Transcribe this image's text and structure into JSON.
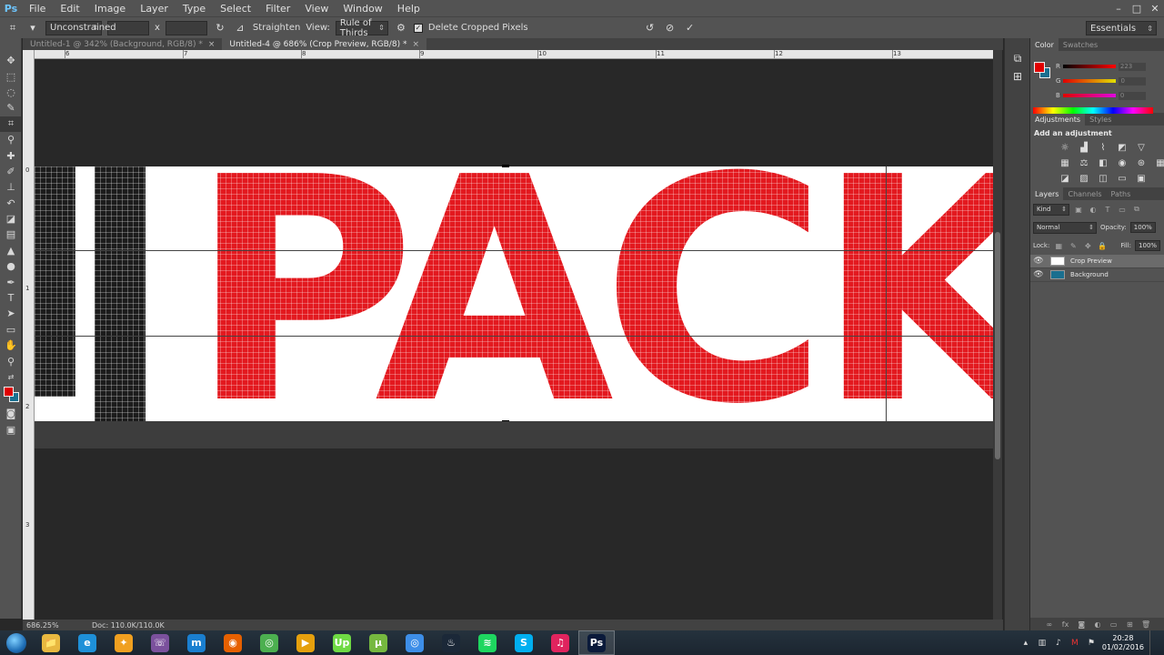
{
  "app": {
    "logo": "Ps"
  },
  "menu": [
    "File",
    "Edit",
    "Image",
    "Layer",
    "Type",
    "Select",
    "Filter",
    "View",
    "Window",
    "Help"
  ],
  "window_controls": [
    "–",
    "□",
    "✕"
  ],
  "options": {
    "ratio_select": "Unconstrained",
    "swap_label": "x",
    "straighten_label": "Straighten",
    "view_label": "View:",
    "view_select": "Rule of Thirds",
    "delete_cropped_label": "Delete Cropped Pixels",
    "delete_cropped_checked": true,
    "workspace": "Essentials"
  },
  "tabs": [
    {
      "label": "Untitled-1 @ 342% (Background, RGB/8) *",
      "active": false
    },
    {
      "label": "Untitled-4 @ 686% (Crop Preview, RGB/8) *",
      "active": true
    }
  ],
  "ruler_top": [
    "6",
    "7",
    "8",
    "9",
    "10",
    "11",
    "12",
    "13"
  ],
  "ruler_left": [
    "0",
    "1",
    "2",
    "3"
  ],
  "canvas": {
    "text": "PACK",
    "partial_letter": "d"
  },
  "status": {
    "zoom": "686.25%",
    "doc": "Doc: 110.0K/110.0K"
  },
  "panels": {
    "color_tabs": [
      "Color",
      "Swatches"
    ],
    "color": {
      "r_label": "R",
      "g_label": "G",
      "b_label": "B",
      "r_value": "223",
      "g_value": "0",
      "b_value": "0"
    },
    "adjust_tabs": [
      "Adjustments",
      "Styles"
    ],
    "adjust_title": "Add an adjustment",
    "layers_tabs": [
      "Layers",
      "Channels",
      "Paths"
    ],
    "kind_select": "Kind",
    "blend_mode": "Normal",
    "opacity_label": "Opacity:",
    "opacity_value": "100%",
    "lock_label": "Lock:",
    "fill_label": "Fill:",
    "fill_value": "100%",
    "layers": [
      {
        "name": "Crop Preview",
        "selected": true
      },
      {
        "name": "Background",
        "selected": false
      }
    ]
  },
  "taskbar": {
    "icons": [
      {
        "name": "explorer",
        "glyph": "📁",
        "color": "#e8b840"
      },
      {
        "name": "ie",
        "glyph": "e",
        "color": "#1e90d8"
      },
      {
        "name": "media",
        "glyph": "✦",
        "color": "#f0a020"
      },
      {
        "name": "viber",
        "glyph": "☏",
        "color": "#7b519d"
      },
      {
        "name": "maxthon",
        "glyph": "m",
        "color": "#1a7fd0"
      },
      {
        "name": "firefox",
        "glyph": "◉",
        "color": "#e66000"
      },
      {
        "name": "chrome",
        "glyph": "◎",
        "color": "#4caf50"
      },
      {
        "name": "plex",
        "glyph": "▶",
        "color": "#e5a00d"
      },
      {
        "name": "upwork",
        "glyph": "Up",
        "color": "#6fda44"
      },
      {
        "name": "utorrent",
        "glyph": "µ",
        "color": "#76b83f"
      },
      {
        "name": "chrome2",
        "glyph": "◎",
        "color": "#3d8ee8"
      },
      {
        "name": "steam",
        "glyph": "♨",
        "color": "#1b2838"
      },
      {
        "name": "spotify",
        "glyph": "≋",
        "color": "#1ed760"
      },
      {
        "name": "skype",
        "glyph": "S",
        "color": "#00aff0"
      },
      {
        "name": "itunes",
        "glyph": "♫",
        "color": "#e0245e"
      },
      {
        "name": "photoshop",
        "glyph": "Ps",
        "color": "#0a1a3a"
      }
    ],
    "time": "20:28",
    "date": "01/02/2016"
  }
}
